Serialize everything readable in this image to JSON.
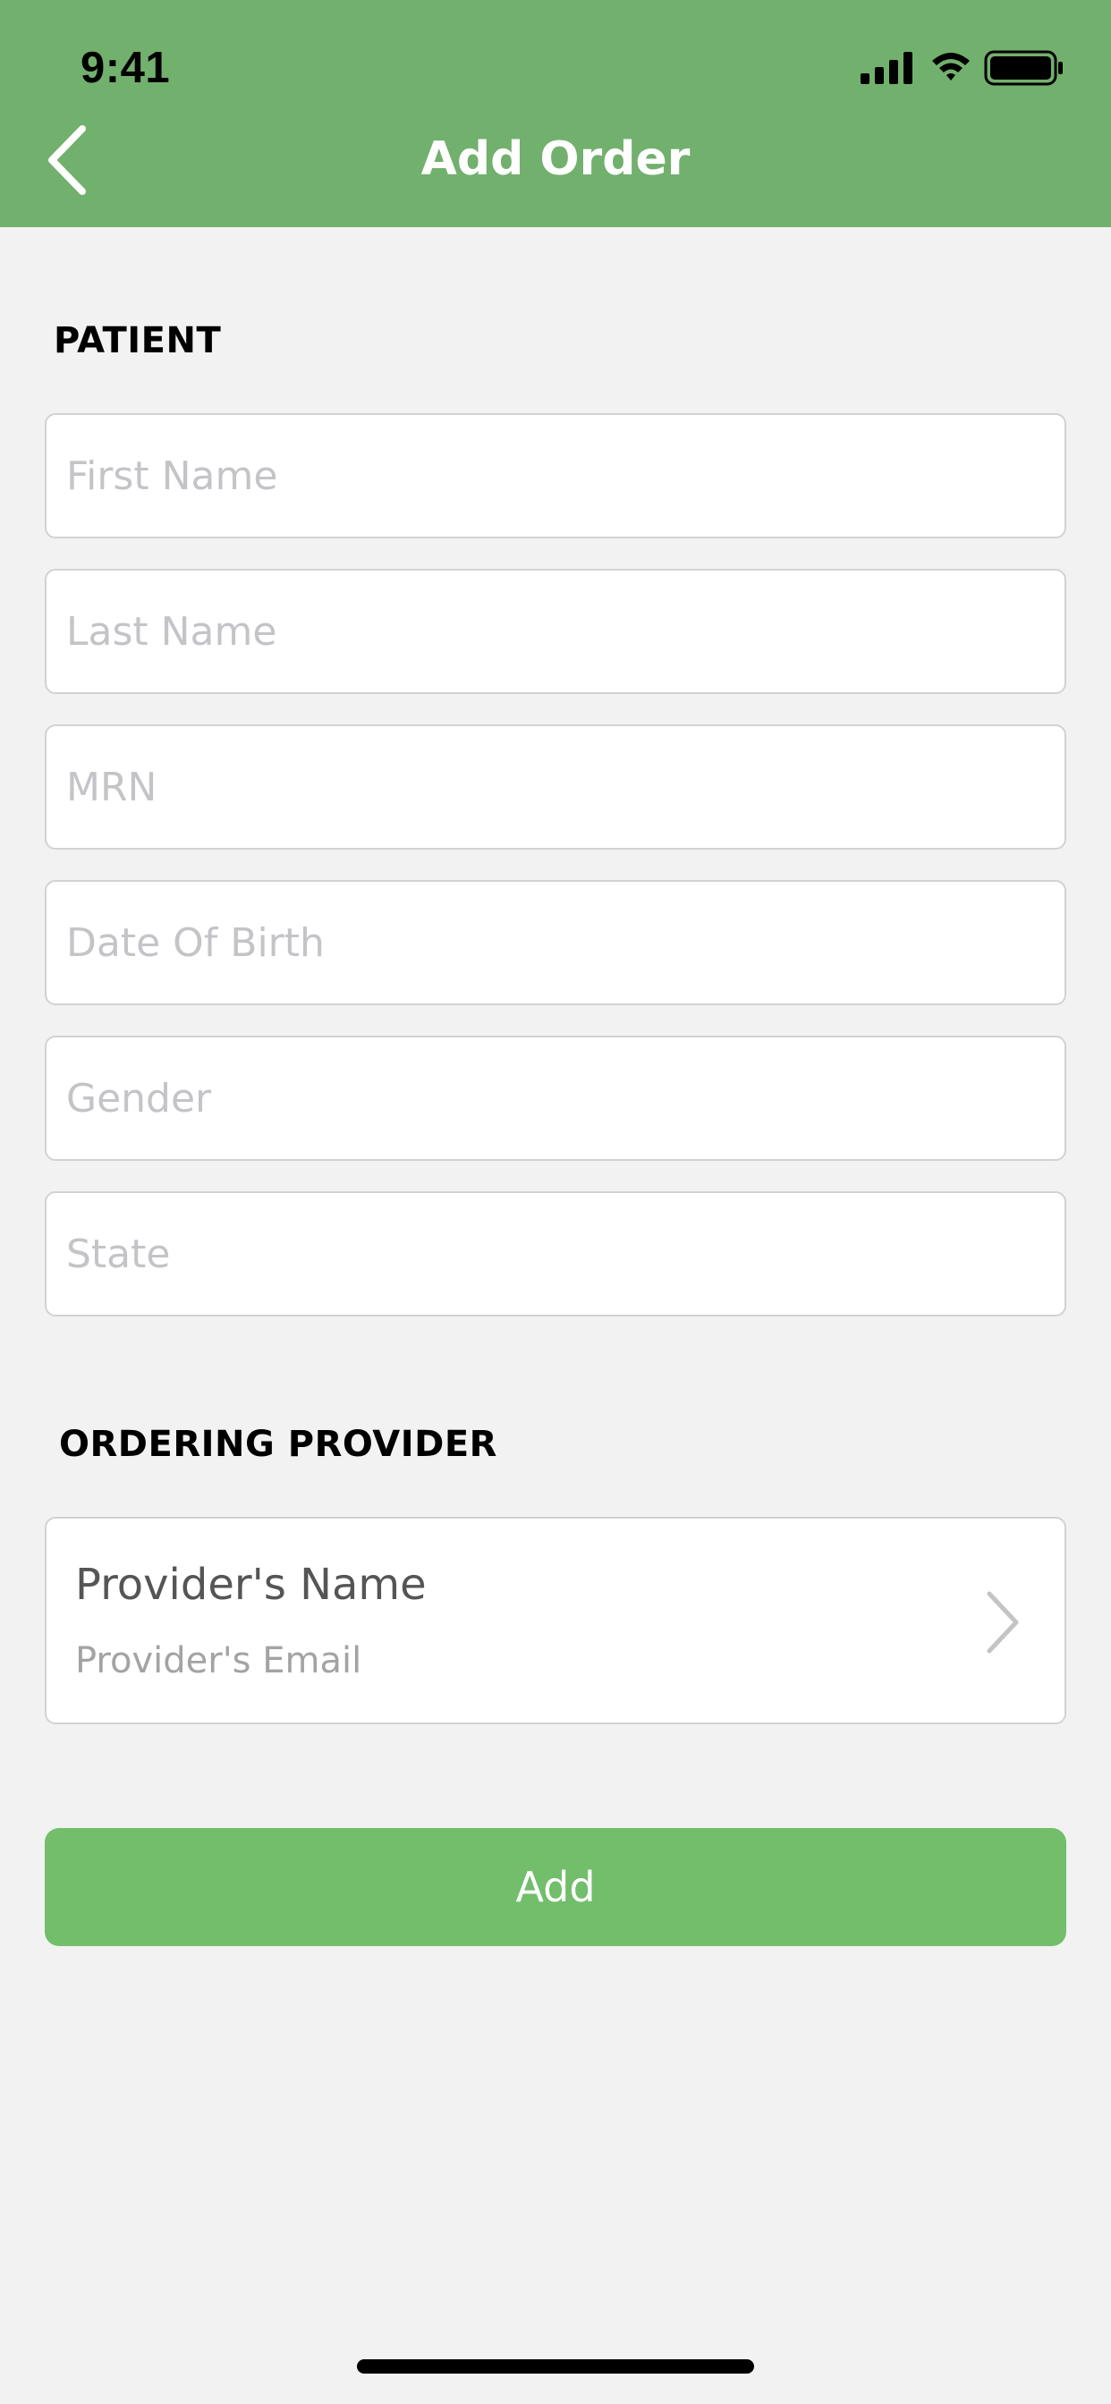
{
  "status_bar": {
    "time": "9:41",
    "icons": [
      "cellular-signal-icon",
      "wifi-icon",
      "battery-icon"
    ]
  },
  "nav": {
    "title": "Add Order",
    "back_icon": "chevron-left-icon"
  },
  "patient": {
    "section_label": "PATIENT",
    "fields": {
      "first_name": {
        "placeholder": "First Name",
        "value": ""
      },
      "last_name": {
        "placeholder": "Last Name",
        "value": ""
      },
      "mrn": {
        "placeholder": "MRN",
        "value": ""
      },
      "dob": {
        "placeholder": "Date Of Birth",
        "value": ""
      },
      "gender": {
        "placeholder": "Gender",
        "value": ""
      },
      "state": {
        "placeholder": "State",
        "value": ""
      }
    }
  },
  "provider": {
    "section_label": "ORDERING PROVIDER",
    "name": "Provider's Name",
    "email": "Provider's Email",
    "chevron_icon": "chevron-right-icon"
  },
  "actions": {
    "add_label": "Add"
  },
  "colors": {
    "header": "#72b06d",
    "add_button": "#72be6a",
    "background": "#f2f2f2"
  }
}
